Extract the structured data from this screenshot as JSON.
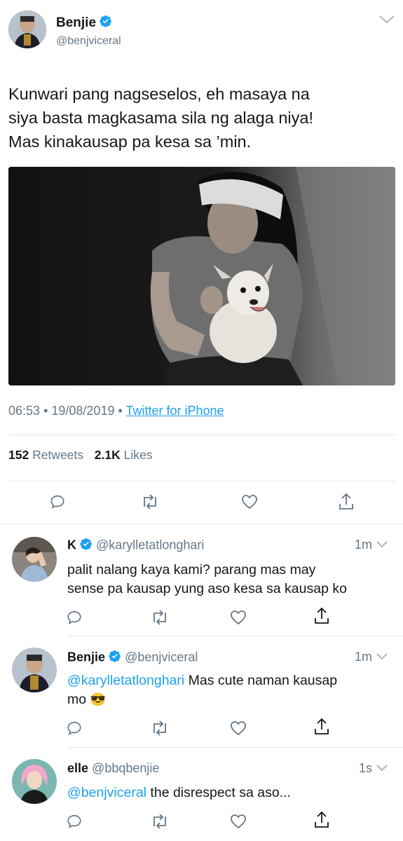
{
  "main_tweet": {
    "author_name": "Benjie",
    "author_handle": "@benjviceral",
    "text_line1": "Kunwari pang nagseselos, eh masaya na",
    "text_line2": "siya basta magkasama sila ng alaga niya!",
    "text_line3": "Mas kinakausap pa kesa sa ’min.",
    "time": "06:53",
    "date": "19/08/2019",
    "source": "Twitter for iPhone",
    "retweets_count": "152",
    "retweets_label": "Retweets",
    "likes_count": "2.1K",
    "likes_label": "Likes"
  },
  "replies": [
    {
      "name": "K",
      "handle": "@karylletatlonghari",
      "time": "1m",
      "line1": "palit nalang kaya kami? parang mas may",
      "line2": "sense pa kausap yung aso kesa sa kausap ko"
    },
    {
      "name": "Benjie",
      "handle": "@benjviceral",
      "time": "1m",
      "mention": "@karylletatlonghari",
      "line1_rest": " Mas cute naman kausap",
      "line2": "mo",
      "emoji": "😎"
    },
    {
      "name": "elle",
      "handle": "@bbqbenjie",
      "time": "1s",
      "mention": "@benjviceral",
      "line1_rest": " the disrespect sa aso..."
    }
  ],
  "icons": [
    "reply-icon",
    "retweet-icon",
    "like-icon",
    "share-icon",
    "verified-badge-icon",
    "chevron-down-icon"
  ],
  "colors": {
    "link": "#1da1f2",
    "secondary": "#657786",
    "divider": "#e1e8ed",
    "verified": "#1da1f2"
  }
}
